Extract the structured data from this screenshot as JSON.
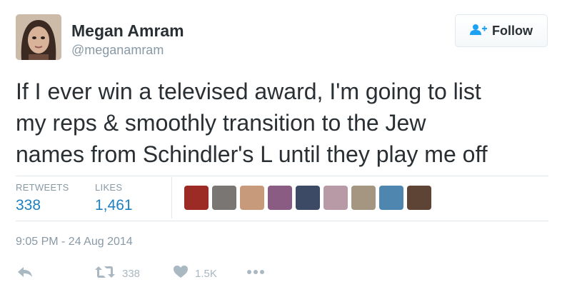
{
  "user": {
    "name": "Megan Amram",
    "handle": "@meganamram"
  },
  "follow_button": {
    "label": "Follow",
    "icon": "user-plus-icon",
    "icon_color": "#1da1f2"
  },
  "tweet": {
    "lines": [
      "If I ever win a televised award, I'm going to list",
      "my reps & smoothly transition to the Jew",
      "names from Schindler's L until they play me off"
    ],
    "timestamp": "9:05 PM - 24 Aug 2014"
  },
  "stats": {
    "retweets_label": "RETWEETS",
    "retweets_value": "338",
    "likes_label": "LIKES",
    "likes_value": "1,461"
  },
  "likers": [
    {
      "color": "#9b2b24"
    },
    {
      "color": "#7a7673"
    },
    {
      "color": "#c79a7c"
    },
    {
      "color": "#8a5c84"
    },
    {
      "color": "#3c4a66"
    },
    {
      "color": "#b89aa6"
    },
    {
      "color": "#a59682"
    },
    {
      "color": "#4e86b0"
    },
    {
      "color": "#5d4434"
    }
  ],
  "actions": {
    "reply_icon": "reply-icon",
    "retweet_icon": "retweet-icon",
    "retweet_count": "338",
    "like_icon": "heart-icon",
    "like_count": "1.5K",
    "more_icon": "more-icon"
  },
  "colors": {
    "link": "#1f80c0",
    "muted": "#8899a6",
    "action": "#aab8c2"
  }
}
